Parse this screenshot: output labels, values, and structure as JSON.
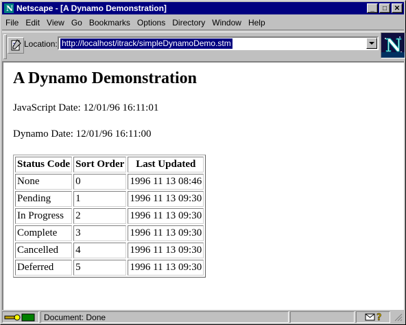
{
  "window": {
    "title": "Netscape - [A Dynamo Demonstration]",
    "controls": {
      "minimize": "_",
      "maximize": "□",
      "close": "✕"
    }
  },
  "menu": [
    "File",
    "Edit",
    "View",
    "Go",
    "Bookmarks",
    "Options",
    "Directory",
    "Window",
    "Help"
  ],
  "location": {
    "label": "Location:",
    "url": "http://localhost/itrack/simpleDynamoDemo.stm"
  },
  "logo": "N",
  "page": {
    "heading": "A Dynamo Demonstration",
    "js_date": "JavaScript Date: 12/01/96 16:11:01",
    "dynamo_date": "Dynamo Date: 12/01/96 16:11:00",
    "table": {
      "headers": [
        "Status Code",
        "Sort Order",
        "Last Updated"
      ],
      "rows": [
        [
          "None",
          "0",
          "1996 11 13 08:46"
        ],
        [
          "Pending",
          "1",
          "1996 11 13 09:30"
        ],
        [
          "In Progress",
          "2",
          "1996 11 13 09:30"
        ],
        [
          "Complete",
          "3",
          "1996 11 13 09:30"
        ],
        [
          "Cancelled",
          "4",
          "1996 11 13 09:30"
        ],
        [
          "Deferred",
          "5",
          "1996 11 13 09:30"
        ]
      ]
    }
  },
  "status": {
    "text": "Document: Done",
    "icons": [
      "security-key-icon",
      "mail-icon",
      "help-icon"
    ]
  }
}
